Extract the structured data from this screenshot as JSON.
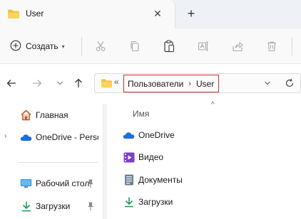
{
  "window": {
    "tab_title": "User",
    "close_tab_glyph": "✕",
    "new_tab_glyph": "+"
  },
  "toolbar": {
    "create_label": "Создать",
    "create_chevron": "▾",
    "buttons": [
      "cut-icon",
      "copy-icon",
      "paste-icon",
      "rename-icon",
      "share-icon",
      "delete-icon"
    ]
  },
  "address_bar": {
    "back_glyph": "←",
    "history_glyph": "«",
    "crumbs": [
      "Пользователи",
      "User"
    ],
    "crumb_separator": "›"
  },
  "sidebar": {
    "items": [
      {
        "label": "Главная",
        "icon": "home-icon"
      },
      {
        "label": "OneDrive - Personal",
        "icon": "onedrive-icon",
        "expand": "›"
      },
      {
        "label": "Рабочий стол",
        "icon": "desktop-icon",
        "pinned": true
      },
      {
        "label": "Загрузки",
        "icon": "downloads-icon",
        "pinned": true
      }
    ]
  },
  "content": {
    "sort_caret": "^",
    "column_name": "Имя",
    "items": [
      {
        "label": "OneDrive",
        "icon": "onedrive-icon"
      },
      {
        "label": "Видео",
        "icon": "videos-icon"
      },
      {
        "label": "Документы",
        "icon": "documents-icon"
      },
      {
        "label": "Загрузки",
        "icon": "downloads-icon"
      }
    ]
  },
  "colors": {
    "folder": "#f4c430",
    "highlight_border": "#d12f2f",
    "onedrive": "#1e6fd9",
    "downloads": "#1f9c54",
    "videos": "#7b3fc6"
  }
}
